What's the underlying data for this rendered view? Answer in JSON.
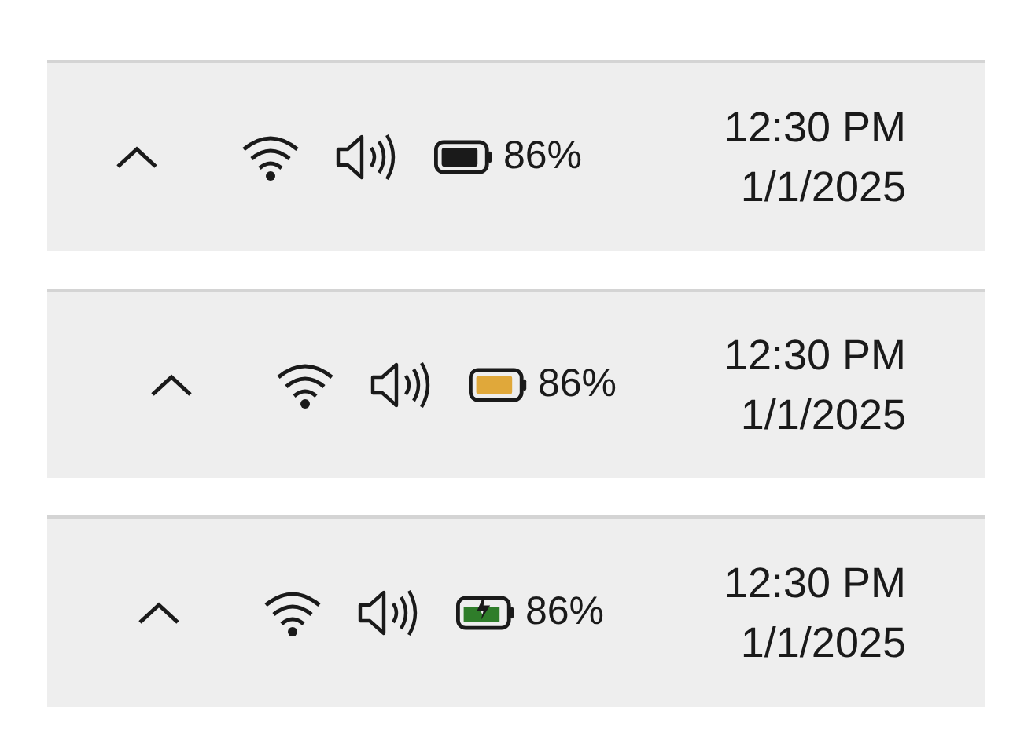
{
  "trays": [
    {
      "battery": {
        "kind": "normal",
        "color": "#1a1a1a"
      },
      "percent": "86%",
      "time": "12:30 PM",
      "date": "1/1/2025"
    },
    {
      "battery": {
        "kind": "saver",
        "color": "#e0a83a"
      },
      "percent": "86%",
      "time": "12:30 PM",
      "date": "1/1/2025"
    },
    {
      "battery": {
        "kind": "charging",
        "color": "#2f7d2a"
      },
      "percent": "86%",
      "time": "12:30 PM",
      "date": "1/1/2025"
    }
  ]
}
